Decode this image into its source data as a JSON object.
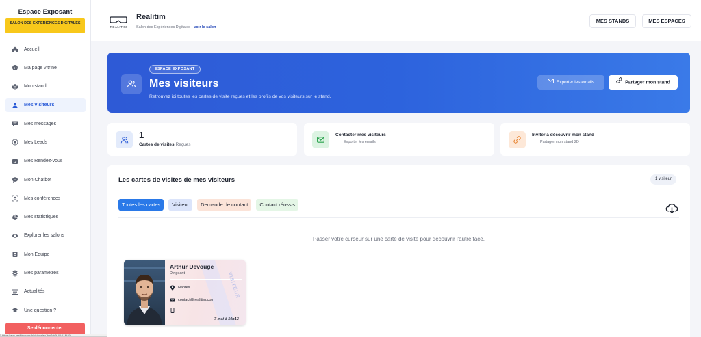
{
  "sidebar": {
    "title": "Espace Exposant",
    "event_badge": "SALON DES EXPÉRIENCES DIGITALES",
    "items": [
      {
        "label": "Accueil",
        "icon": "home-icon"
      },
      {
        "label": "Ma page vitrine",
        "icon": "globe-icon"
      },
      {
        "label": "Mon stand",
        "icon": "cube-icon"
      },
      {
        "label": "Mes visiteurs",
        "icon": "user-icon",
        "active": true
      },
      {
        "label": "Mes messages",
        "icon": "message-icon"
      },
      {
        "label": "Mes Leads",
        "icon": "target-icon"
      },
      {
        "label": "Mes Rendez-vous",
        "icon": "calendar-icon"
      },
      {
        "label": "Mon Chatbot",
        "icon": "chat-icon"
      },
      {
        "label": "Mes conférences",
        "icon": "conference-icon"
      },
      {
        "label": "Mes statistiques",
        "icon": "pie-chart-icon"
      },
      {
        "label": "Explorer les salons",
        "icon": "eye-icon"
      },
      {
        "label": "Mon Equipe",
        "icon": "team-icon"
      },
      {
        "label": "Mes paramètres",
        "icon": "gear-icon"
      },
      {
        "label": "Actualités",
        "icon": "news-icon"
      },
      {
        "label": "Une question ?",
        "icon": "help-icon"
      }
    ],
    "logout_label": "Se déconnecter"
  },
  "header": {
    "logo_text": "REALITIM",
    "brand": "Realitim",
    "subtitle": "Salon des Expériences Digitales",
    "link": "voir le salon",
    "btn_stands": "MES STANDS",
    "btn_espaces": "MES ESPACES"
  },
  "hero": {
    "pill": "ESPACE EXPOSANT",
    "title": "Mes visiteurs",
    "description": "Retrouvez ici toutes les cartes de visite reçues et les profils de vos visiteurs sur le stand.",
    "export_label": "Exporter les emails",
    "share_label": "Partager mon stand"
  },
  "stats": {
    "count": "1",
    "count_label": "Cartes de visites",
    "count_suffix": "Reçues",
    "contact_title": "Contacter mes visiteurs",
    "contact_sub": "Exporter les emails",
    "invite_title": "Inviter à découvrir mon stand",
    "invite_sub": "Partager mon stand 2D"
  },
  "panel": {
    "title": "Les cartes de visites de mes visiteurs",
    "badge": "1 visiteur",
    "filters": [
      "Toutes les cartes",
      "Visiteur",
      "Demande de contact",
      "Contact réussis"
    ],
    "hint": "Passer votre curseur sur une carte de visite pour découvrir l'autre face."
  },
  "card": {
    "name": "Arthur Devouge",
    "role": "Dirigeant",
    "city": "Nantes",
    "email": "contact@realitim.com",
    "phone": "",
    "date": "7 mai à 10h13",
    "watermark": "VISITEUR"
  },
  "statusbar": {
    "url": "https://app.realitim.com/fr/visitors/eyJhbGciOiJIUzI1NiJ9"
  },
  "colors": {
    "accent": "#2a5bd7",
    "badge": "#f8c81b",
    "logout": "#f26060"
  }
}
